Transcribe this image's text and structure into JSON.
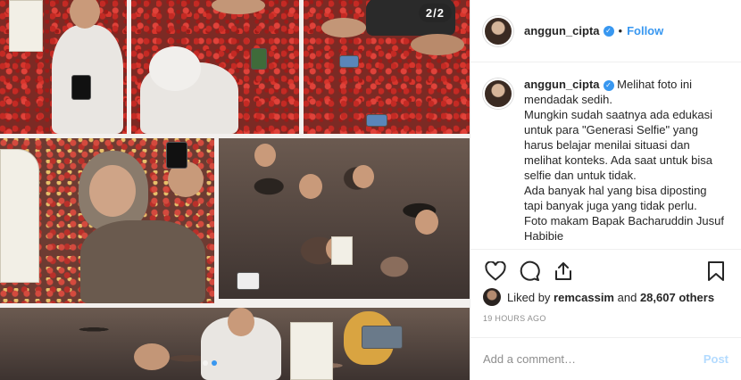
{
  "media": {
    "counter": "2/2",
    "slide_count": 2,
    "active_slide": 1
  },
  "header": {
    "username": "anggun_cipta",
    "separator": "•",
    "follow_label": "Follow"
  },
  "caption": {
    "username": "anggun_cipta",
    "lines": [
      "Melihat foto ini",
      "mendadak sedih.",
      "Mungkin sudah saatnya ada edukasi",
      "untuk para \"Generasi Selfie\" yang",
      "harus belajar menilai situasi dan",
      "melihat konteks. Ada saat untuk bisa",
      "selfie dan untuk tidak.",
      "Ada banyak hal yang bisa diposting",
      "tapi banyak juga yang tidak perlu.",
      "Foto makam Bapak Bacharuddin Jusuf",
      "Habibie"
    ]
  },
  "actions": {
    "like_icon": "heart-icon",
    "comment_icon": "comment-icon",
    "share_icon": "share-icon",
    "save_icon": "bookmark-icon"
  },
  "likes": {
    "prefix": "Liked by ",
    "user": "remcassim",
    "middle": " and ",
    "count": "28,607 others"
  },
  "timestamp": "19 HOURS AGO",
  "comment": {
    "placeholder": "Add a comment…",
    "post_label": "Post"
  },
  "colors": {
    "accent": "#3897f0",
    "post_disabled": "#b3dbff",
    "muted": "#8e8e8e",
    "text": "#262626"
  }
}
